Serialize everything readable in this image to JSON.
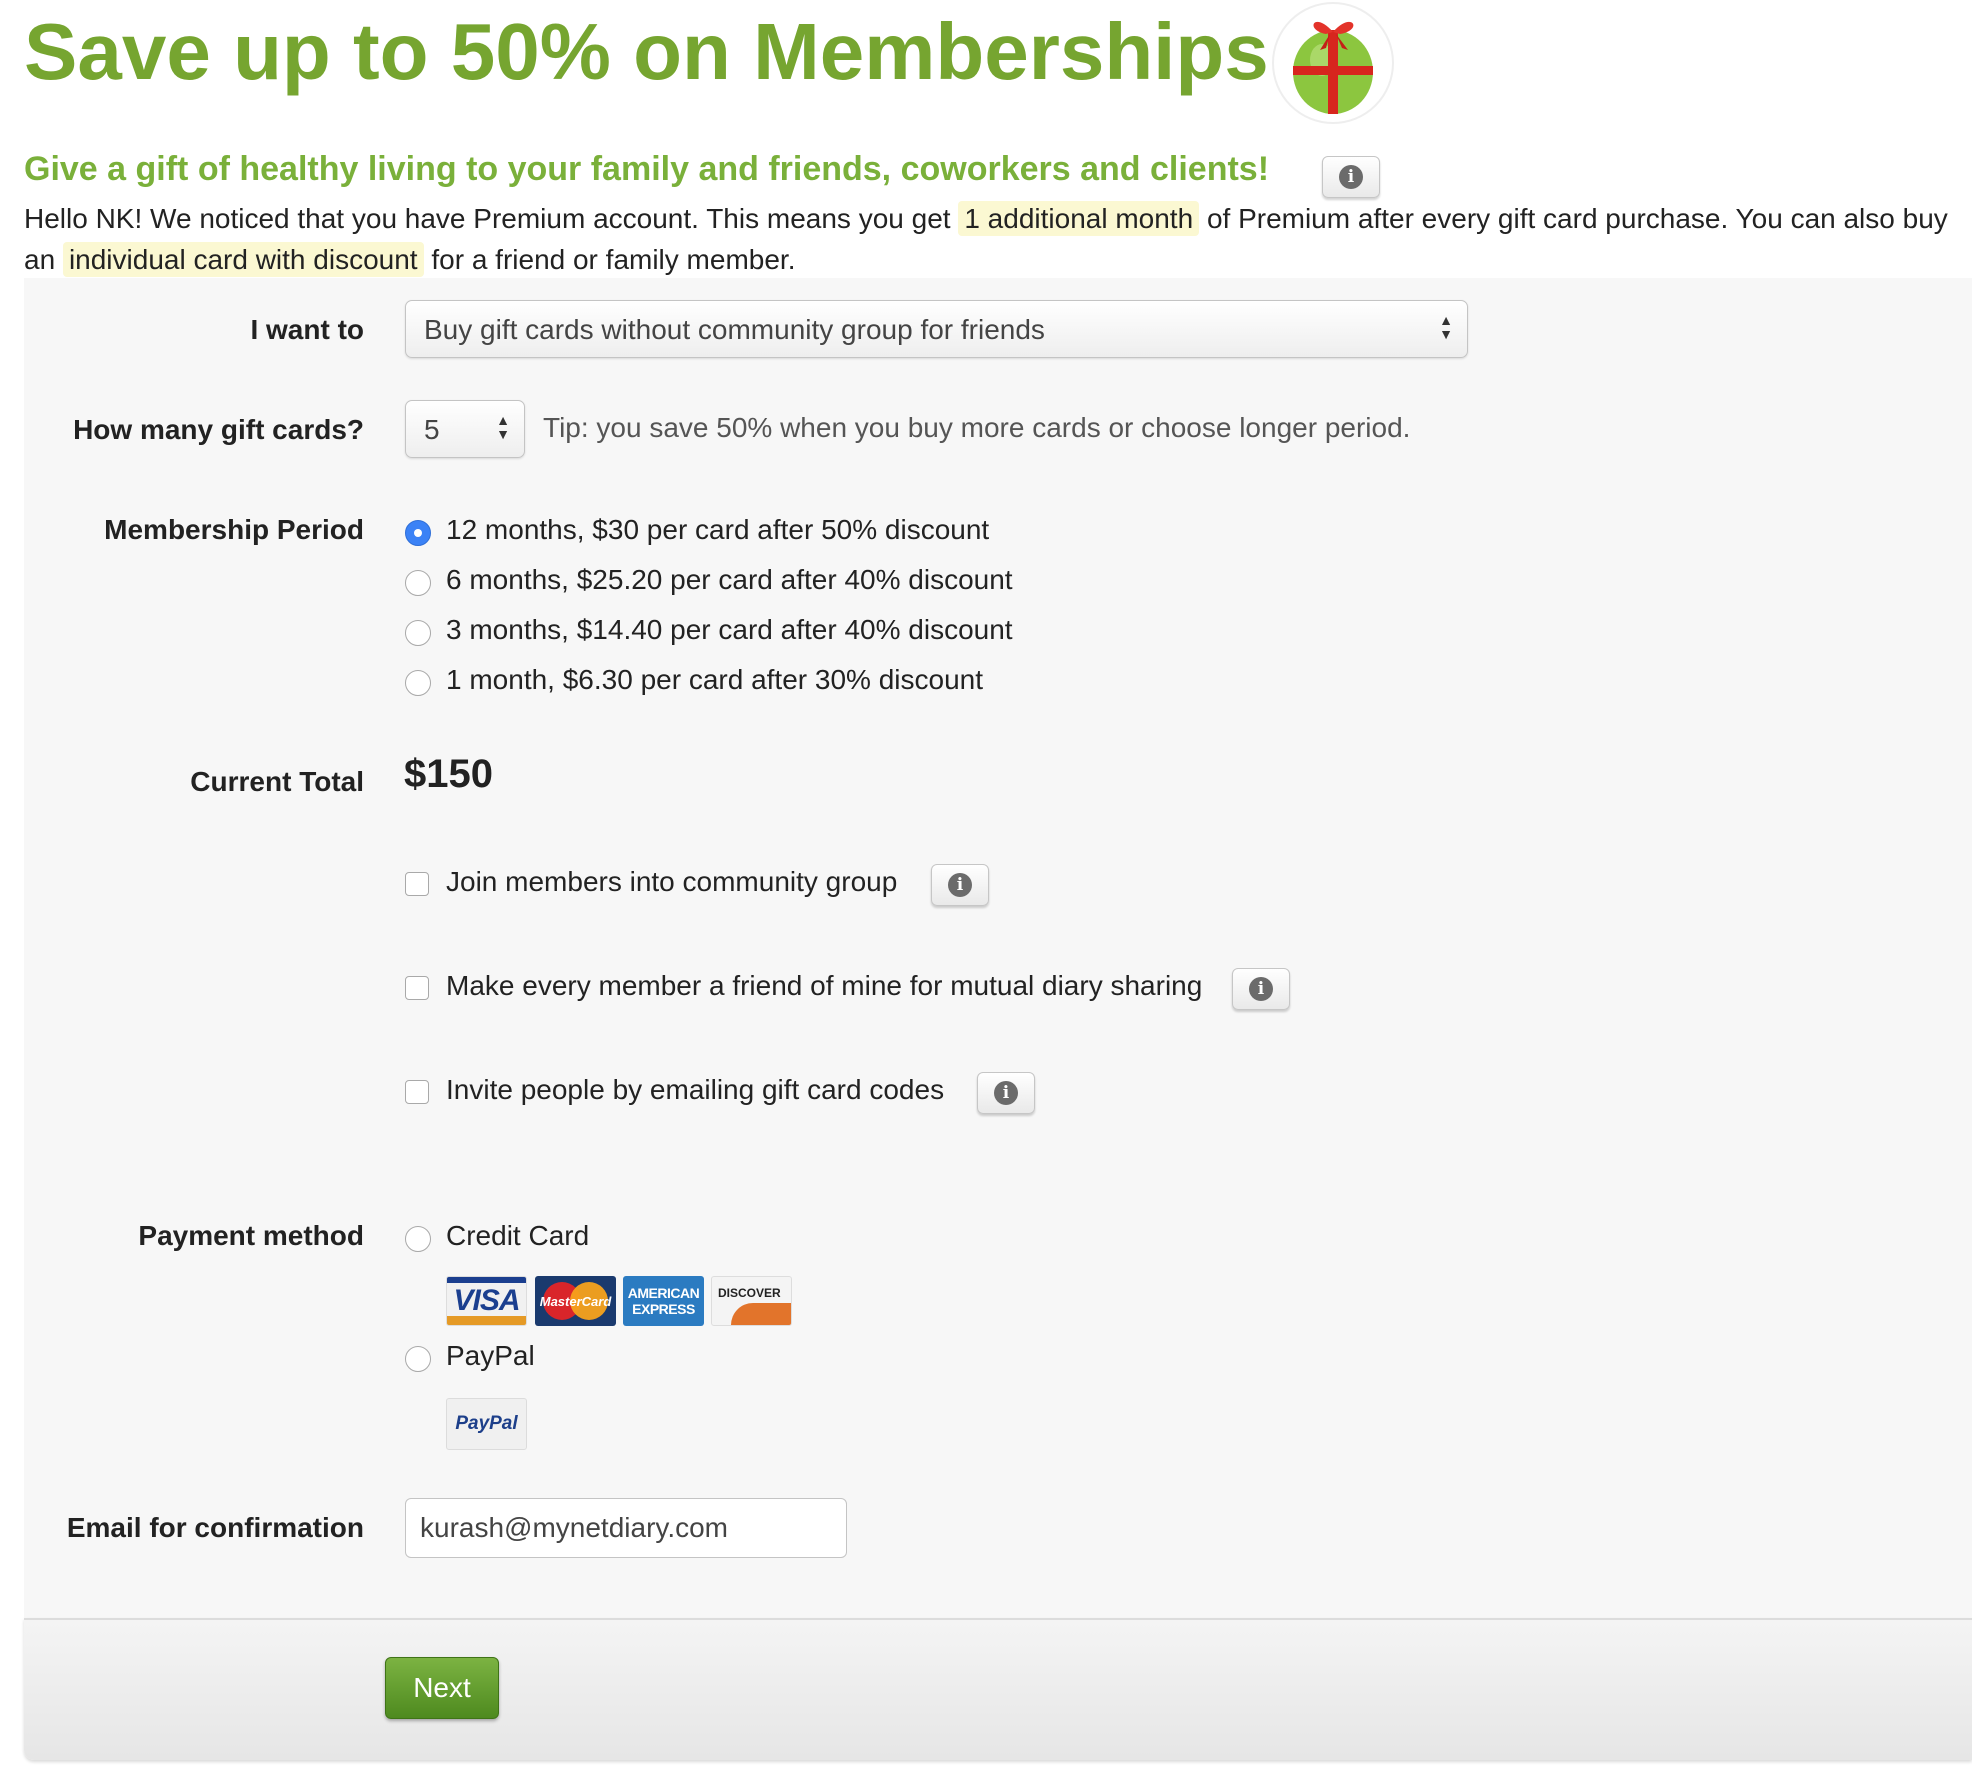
{
  "header": {
    "title": "Save up to 50% on Memberships",
    "subtitle": "Give a gift of healthy living to your family and friends, coworkers and clients!"
  },
  "intro": {
    "part1": "Hello NK! We noticed that you have Premium account. This means you get",
    "highlight1": "1 additional month",
    "part2": "of Premium after every gift card purchase. You can also buy an",
    "highlight2": "individual card with discount",
    "part3": "for a friend or family member."
  },
  "form": {
    "want_label": "I want to",
    "want_value": "Buy gift cards without community group for friends",
    "count_label": "How many gift cards?",
    "count_value": "5",
    "tip": "Tip: you save 50% when you buy more cards or choose longer period.",
    "period_label": "Membership Period",
    "periods": [
      {
        "label": "12 months, $30 per card after 50% discount",
        "selected": true
      },
      {
        "label": "6 months, $25.20 per card after 40% discount",
        "selected": false
      },
      {
        "label": "3 months, $14.40 per card after 40% discount",
        "selected": false
      },
      {
        "label": "1 month, $6.30 per card after 30% discount",
        "selected": false
      }
    ],
    "total_label": "Current Total",
    "total_value": "$150",
    "options": [
      {
        "label": "Join members into community group",
        "checked": false
      },
      {
        "label": "Make every member a friend of mine for mutual diary sharing",
        "checked": false
      },
      {
        "label": "Invite people by emailing gift card codes",
        "checked": false
      }
    ],
    "payment_label": "Payment method",
    "payment_methods": [
      {
        "label": "Credit Card",
        "selected": false
      },
      {
        "label": "PayPal",
        "selected": false
      }
    ],
    "card_logos": {
      "visa": "VISA",
      "mastercard": "MasterCard",
      "amex_line1": "AMERICAN",
      "amex_line2": "EXPRESS",
      "discover": "DISCOVER",
      "paypal": "PayPal"
    },
    "email_label": "Email for confirmation",
    "email_value": "kurash@mynetdiary.com"
  },
  "footer": {
    "next_label": "Next"
  },
  "colors": {
    "title_green": "#76a530",
    "subtitle_green": "#7ab03a",
    "highlight": "#fbf8d2",
    "radio_selected": "#3b82f6",
    "button_green": "#5f9a2a"
  },
  "icons": {
    "info": "info-icon",
    "gift_apple": "gift-apple-icon"
  }
}
